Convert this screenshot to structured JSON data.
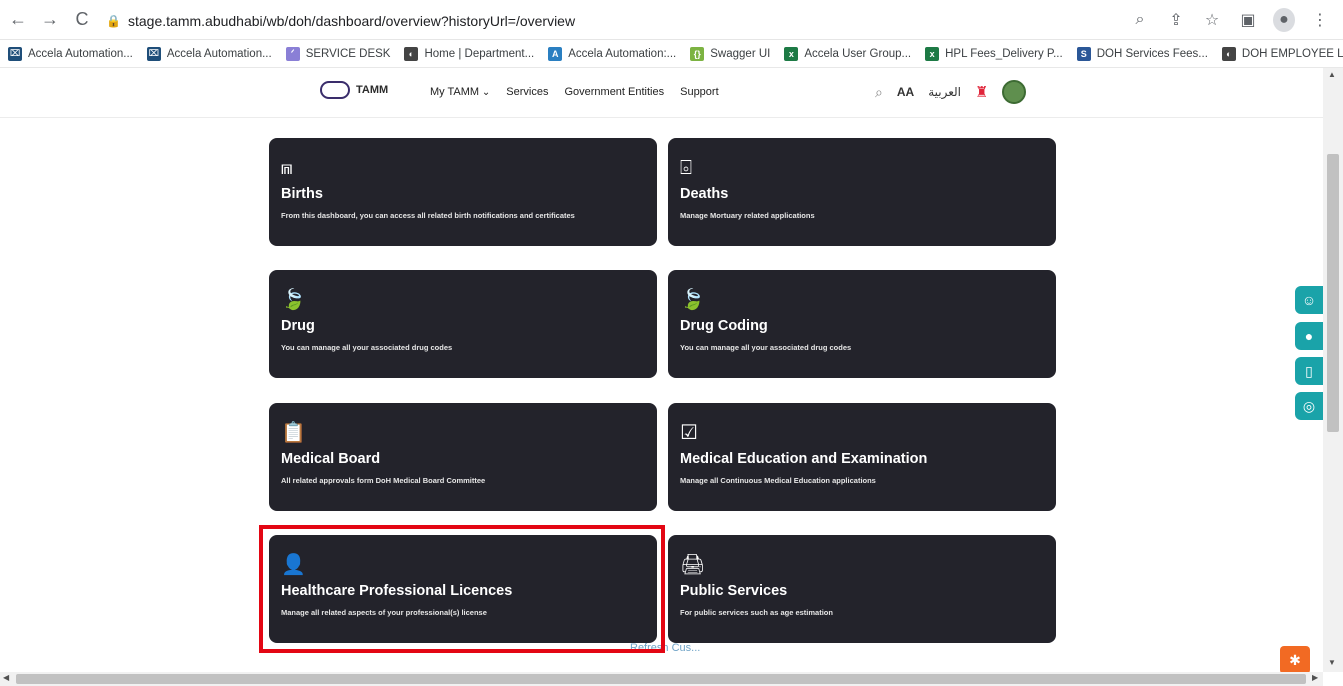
{
  "browser": {
    "url": "stage.tamm.abudhabi/wb/doh/dashboard/overview?historyUrl=/overview",
    "bookmarks": [
      {
        "label": "Accela Automation...",
        "color": "#1f4e79",
        "glyph": "⌧"
      },
      {
        "label": "Accela Automation...",
        "color": "#1f4e79",
        "glyph": "⌧"
      },
      {
        "label": "SERVICE DESK",
        "color": "#8a7fd6",
        "glyph": "ᐟ"
      },
      {
        "label": "Home | Department...",
        "color": "#444",
        "glyph": "◐"
      },
      {
        "label": "Accela Automation:...",
        "color": "#2a7fc1",
        "glyph": "A"
      },
      {
        "label": "Swagger UI",
        "color": "#7cb342",
        "glyph": "{}"
      },
      {
        "label": "Accela User Group...",
        "color": "#1d7a45",
        "glyph": "x"
      },
      {
        "label": "HPL Fees_Delivery P...",
        "color": "#1d7a45",
        "glyph": "x"
      },
      {
        "label": "DOH Services Fees...",
        "color": "#2b5797",
        "glyph": "S"
      },
      {
        "label": "DOH EMPLOYEE LO...",
        "color": "#444",
        "glyph": "◐"
      }
    ]
  },
  "header": {
    "logo_text": "TAMM",
    "nav": {
      "my_tamm": "My TAMM",
      "services": "Services",
      "government_entities": "Government Entities",
      "support": "Support"
    },
    "font_size_toggle": "AA",
    "language": "العربية"
  },
  "cards": [
    {
      "id": "births",
      "icon": "⩎",
      "title": "Births",
      "desc": "From this dashboard, you can access all related birth notifications and certificates"
    },
    {
      "id": "deaths",
      "icon": "⌻",
      "title": "Deaths",
      "desc": "Manage Mortuary related applications"
    },
    {
      "id": "drug",
      "icon": "🍃",
      "title": "Drug",
      "desc": "You can manage all your associated drug codes"
    },
    {
      "id": "drug-coding",
      "icon": "🍃",
      "title": "Drug Coding",
      "desc": "You can manage all your associated drug codes"
    },
    {
      "id": "medical-board",
      "icon": "📋",
      "title": "Medical Board",
      "desc": "All related approvals form DoH Medical Board Committee"
    },
    {
      "id": "medical-education",
      "icon": "☑",
      "title": "Medical Education and Examination",
      "desc": "Manage all Continuous Medical Education applications"
    },
    {
      "id": "healthcare-licences",
      "icon": "👤",
      "title": "Healthcare Professional Licences",
      "desc": "Manage all related aspects of your professional(s) license"
    },
    {
      "id": "public-services",
      "icon": "🖨",
      "title": "Public Services",
      "desc": "For public services such as age estimation"
    }
  ],
  "footer_link": "Refresh Cus..."
}
